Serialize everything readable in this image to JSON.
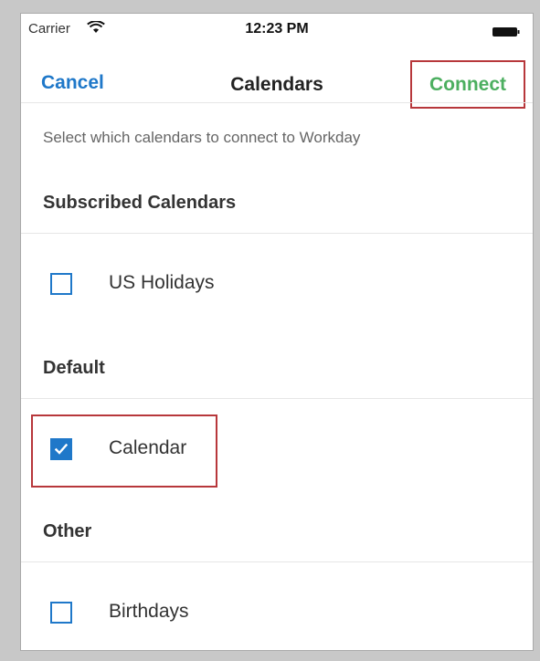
{
  "status_bar": {
    "carrier": "Carrier",
    "time": "12:23 PM"
  },
  "nav": {
    "cancel_label": "Cancel",
    "title": "Calendars",
    "connect_label": "Connect"
  },
  "instructions": "Select which calendars to connect to Workday",
  "sections": [
    {
      "title": "Subscribed Calendars",
      "items": [
        {
          "label": "US Holidays",
          "checked": false
        }
      ]
    },
    {
      "title": "Default",
      "items": [
        {
          "label": "Calendar",
          "checked": true
        }
      ]
    },
    {
      "title": "Other",
      "items": [
        {
          "label": "Birthdays",
          "checked": false
        }
      ]
    }
  ],
  "icons": {
    "wifi": "wifi-icon",
    "battery": "battery-icon",
    "check": "checkmark-icon"
  },
  "colors": {
    "accent_blue": "#1f78c9",
    "connect_green": "#4caf60",
    "highlight_red": "#b7373b"
  }
}
